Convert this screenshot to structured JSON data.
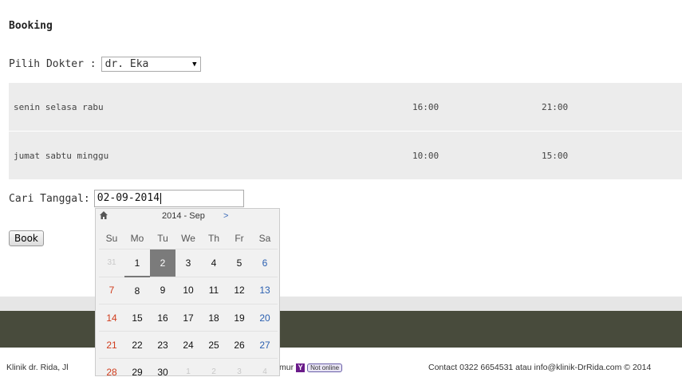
{
  "page": {
    "title": "Booking"
  },
  "doctor": {
    "label": "Pilih Dokter :",
    "selected": "dr. Eka"
  },
  "schedule": [
    {
      "days": "senin selasa rabu",
      "start": "16:00",
      "end": "21:00"
    },
    {
      "days": "jumat sabtu minggu",
      "start": "10:00",
      "end": "15:00"
    }
  ],
  "date_search": {
    "label": "Cari Tanggal:",
    "value": "02-09-2014"
  },
  "book_button": "Book",
  "calendar": {
    "title": "2014 - Sep",
    "next": ">",
    "home_icon": "home-icon",
    "weekdays": [
      "Su",
      "Mo",
      "Tu",
      "We",
      "Th",
      "Fr",
      "Sa"
    ],
    "weeks": [
      [
        "31",
        "1",
        "2",
        "3",
        "4",
        "5",
        "6"
      ],
      [
        "7",
        "8",
        "9",
        "10",
        "11",
        "12",
        "13"
      ],
      [
        "14",
        "15",
        "16",
        "17",
        "18",
        "19",
        "20"
      ],
      [
        "21",
        "22",
        "23",
        "24",
        "25",
        "26",
        "27"
      ],
      [
        "28",
        "29",
        "30",
        "1",
        "2",
        "3",
        "4"
      ]
    ],
    "selected_day": "2",
    "today_day": "1"
  },
  "footer": {
    "left": "Klinik dr. Rida, Jl",
    "mid": "mur",
    "ym_status": "Not online",
    "right": "Contact 0322 6654531 atau info@klinik-DrRida.com © 2014"
  },
  "colors": {
    "footer_dark": "#484b3c",
    "selected_bg": "#7b7b7b",
    "sunday": "#d03c1c",
    "saturday": "#2a5fb0"
  }
}
